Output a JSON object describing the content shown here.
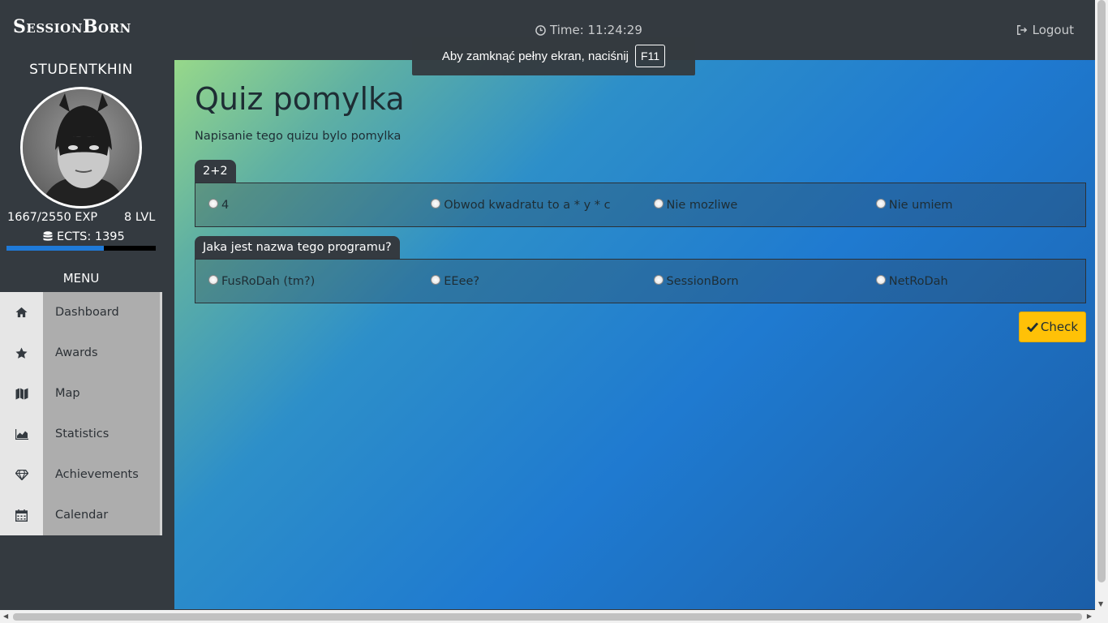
{
  "brand": "SessionBorn",
  "header": {
    "time_text": "Time: 11:24:29",
    "logout_label": "Logout"
  },
  "fullscreen_notice": {
    "text": "Aby zamknąć pełny ekran, naciśnij",
    "key": "F11"
  },
  "user": {
    "name": "STUDENTKHIN",
    "exp_text": "1667/2550 EXP",
    "exp_progress": 0.654,
    "level_text": "8 LVL",
    "ects_text": "ECTS: 1395"
  },
  "menu": {
    "title": "MENU",
    "items": [
      {
        "label": "Dashboard",
        "icon": "home-icon"
      },
      {
        "label": "Awards",
        "icon": "star-icon"
      },
      {
        "label": "Map",
        "icon": "map-icon"
      },
      {
        "label": "Statistics",
        "icon": "area-chart-icon"
      },
      {
        "label": "Achievements",
        "icon": "diamond-icon"
      },
      {
        "label": "Calendar",
        "icon": "calendar-icon"
      }
    ]
  },
  "quiz": {
    "title": "Quiz pomylka",
    "description": "Napisanie tego quizu bylo pomylka",
    "questions": [
      {
        "text": "2+2",
        "options": [
          "4",
          "Obwod kwadratu to a * y * c",
          "Nie mozliwe",
          "Nie umiem"
        ]
      },
      {
        "text": "Jaka jest nazwa tego programu?",
        "options": [
          "FusRoDah (tm?)",
          "EEee?",
          "SessionBorn",
          "NetRoDah"
        ]
      }
    ],
    "check_label": "Check"
  },
  "colors": {
    "topbar": "#343a40",
    "accent_button": "#ffc107",
    "exp_bar": "#1f7ad8"
  }
}
